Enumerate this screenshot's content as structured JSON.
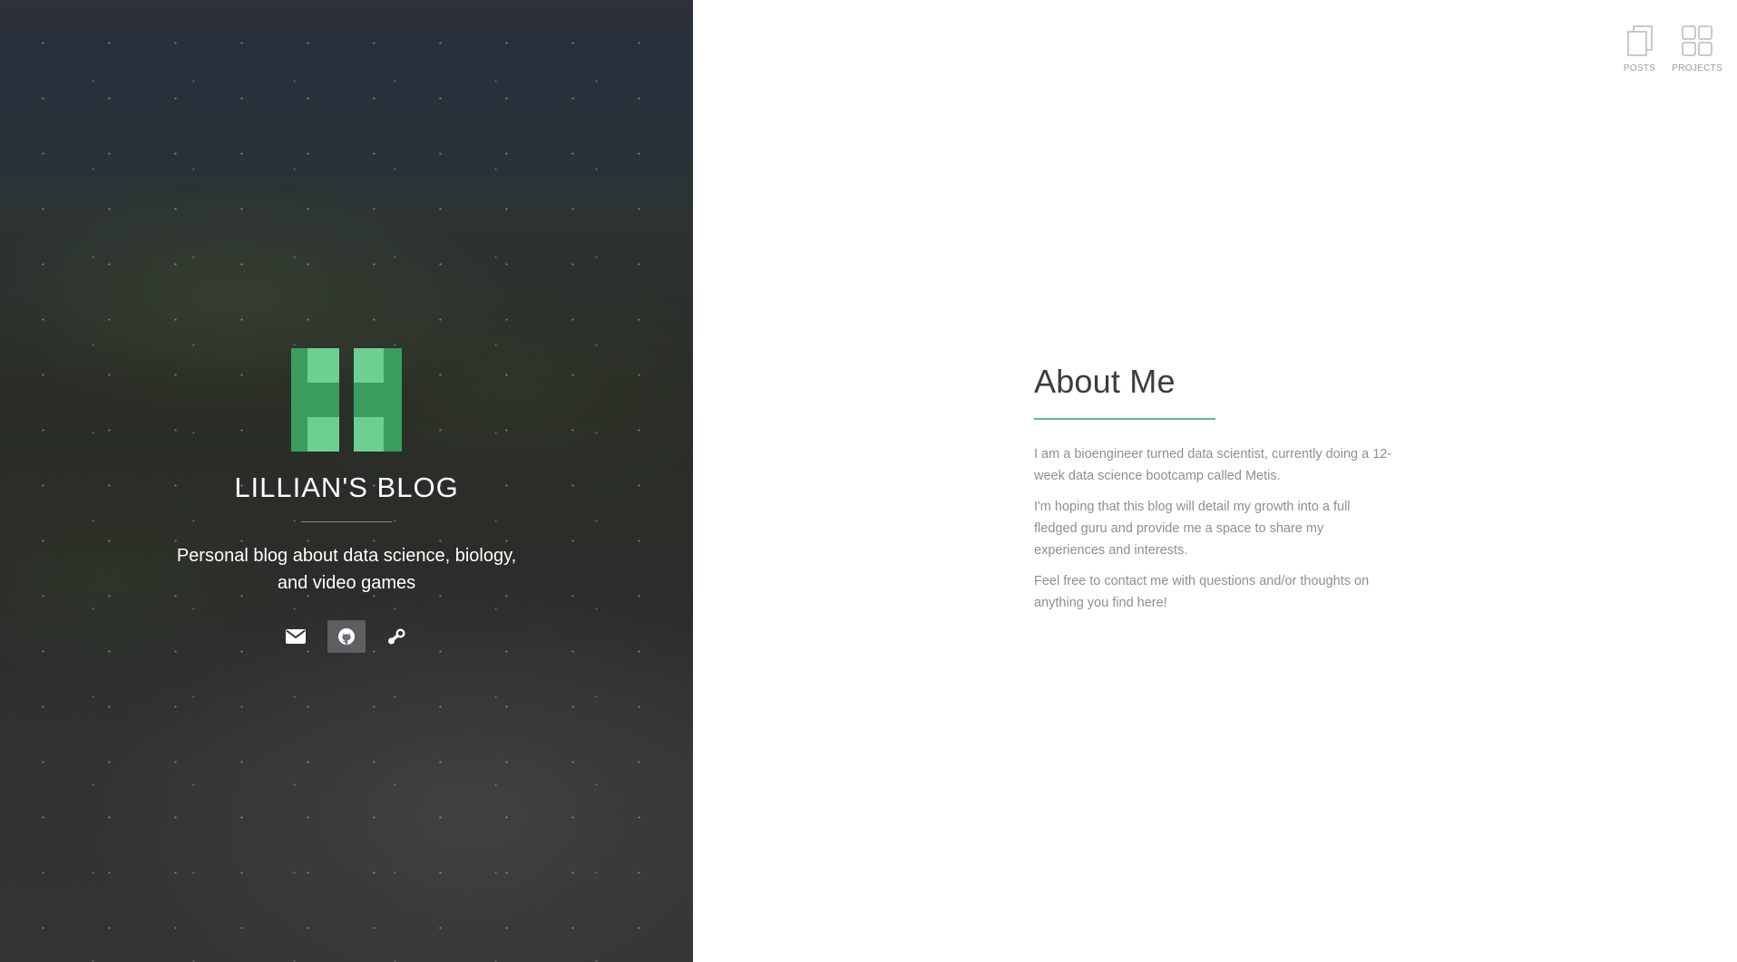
{
  "hero": {
    "title": "LILLIAN'S BLOG",
    "tagline": "Personal blog about data science, biology, and video games",
    "logo_colors": {
      "light": "#6dcf91",
      "dark": "#3a9d5e"
    },
    "social": [
      {
        "name": "email-icon",
        "label": "Email"
      },
      {
        "name": "github-icon",
        "label": "GitHub"
      },
      {
        "name": "steam-icon",
        "label": "Steam"
      }
    ]
  },
  "nav": {
    "posts_label": "POSTS",
    "projects_label": "PROJECTS",
    "posts_icon": "copy-icon",
    "projects_icon": "grid-icon"
  },
  "about": {
    "heading": "About Me",
    "accent": "#58c185",
    "paragraphs": [
      "I am a bioengineer turned data scientist, currently doing a 12-week data science bootcamp called Metis.",
      "I'm hoping that this blog will detail my growth into a full fledged guru and provide me a space to share my experiences and interests.",
      "Feel free to contact me with questions and/or thoughts on anything you find here!"
    ]
  }
}
